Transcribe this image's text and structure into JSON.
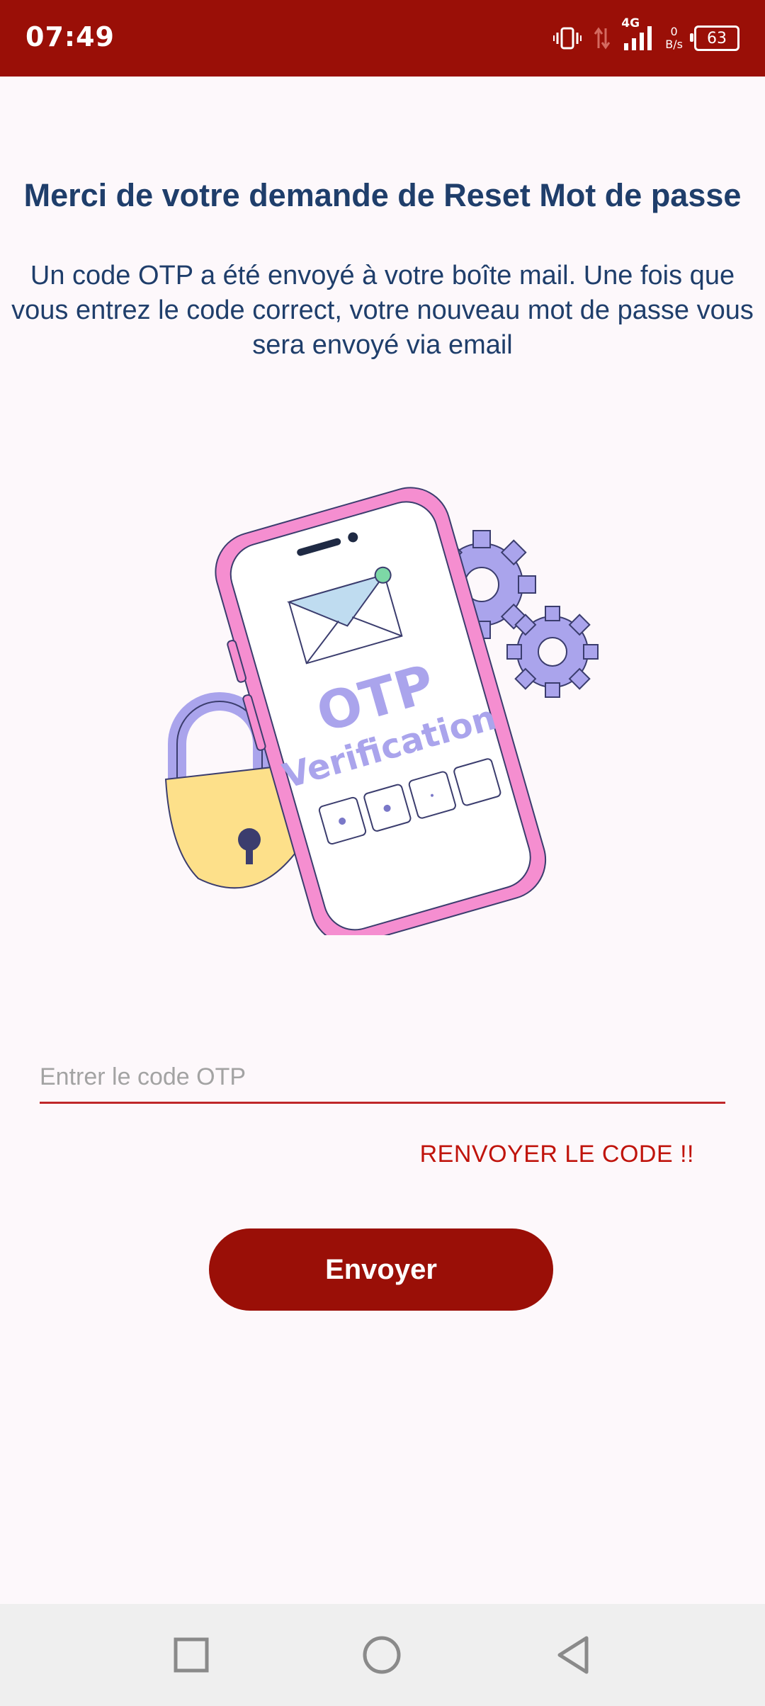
{
  "status_bar": {
    "time": "07:49",
    "network_type": "4G",
    "net_speed_value": "0",
    "net_speed_unit": "B/s",
    "battery_level": "63"
  },
  "content": {
    "title": "Merci de votre demande de Reset Mot de passe",
    "description": "Un code OTP a été envoyé à votre boîte mail. Une fois que vous entrez le code correct, votre nouveau mot de passe vous sera envoyé via email",
    "illustration": {
      "heading": "OTP",
      "subheading": "Verification"
    },
    "otp_field": {
      "placeholder": "Entrer le code OTP",
      "value": ""
    },
    "resend_label": "RENVOYER LE CODE !!",
    "submit_label": "Envoyer"
  },
  "colors": {
    "primary": "#9a0f07",
    "title_text": "#1f3e6b",
    "link": "#c0140c",
    "background": "#fdf8fb"
  }
}
